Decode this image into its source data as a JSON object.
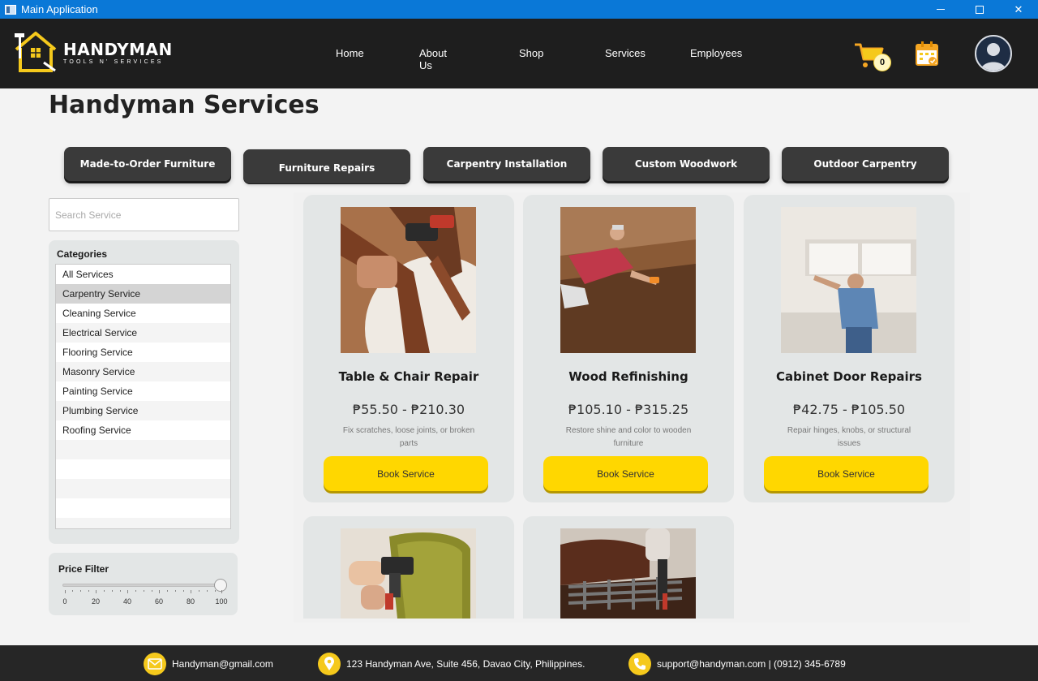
{
  "window": {
    "title": "Main Application",
    "minimize_icon": "minimize-icon",
    "maximize_icon": "maximize-icon",
    "close_glyph": "✕"
  },
  "brand": {
    "name": "HANDYMAN",
    "tagline": "TOOLS N' SERVICES",
    "accent": "#f5c91c"
  },
  "nav": {
    "items": [
      "Home",
      "About Us",
      "Shop",
      "Services",
      "Employees"
    ]
  },
  "header": {
    "cart_count": "0",
    "cart_icon": "cart-icon",
    "calendar_icon": "calendar-icon",
    "avatar_icon": "user-avatar-icon"
  },
  "page": {
    "title": "Handyman Services"
  },
  "tabs": [
    {
      "label": "Made-to-Order Furniture"
    },
    {
      "label": "Furniture Repairs",
      "active": true
    },
    {
      "label": "Carpentry Installation"
    },
    {
      "label": "Custom Woodwork"
    },
    {
      "label": "Outdoor Carpentry"
    }
  ],
  "search": {
    "placeholder": "Search Service",
    "value": ""
  },
  "categories": {
    "title": "Categories",
    "items": [
      "All Services",
      "Carpentry Service",
      "Cleaning Service",
      "Electrical Service",
      "Flooring Service",
      "Masonry Service",
      "Painting Service",
      "Plumbing Service",
      "Roofing Service"
    ],
    "selected": "Carpentry Service"
  },
  "price_filter": {
    "title": "Price Filter",
    "min": 0,
    "max": 100,
    "value": 100,
    "tick_labels": [
      "0",
      "20",
      "40",
      "60",
      "80",
      "100"
    ]
  },
  "services": [
    {
      "name": "Table & Chair Repair",
      "price": "₱55.50 - ₱210.30",
      "desc": "Fix scratches, loose joints, or broken parts",
      "button": "Book Service"
    },
    {
      "name": "Wood Refinishing",
      "price": "₱105.10 - ₱315.25",
      "desc": "Restore shine and color to wooden furniture",
      "button": "Book Service"
    },
    {
      "name": "Cabinet Door Repairs",
      "price": "₱42.75 - ₱105.50",
      "desc": "Repair hinges, knobs, or structural issues",
      "button": "Book Service"
    },
    {
      "name": "",
      "price": "",
      "desc": "",
      "button": ""
    },
    {
      "name": "",
      "price": "",
      "desc": "",
      "button": ""
    }
  ],
  "footer": {
    "email": "Handyman@gmail.com",
    "address": "123 Handyman Ave, Suite 456, Davao City, Philippines.",
    "support": "support@handyman.com | (0912) 345-6789"
  },
  "colors": {
    "header_bg": "#1e1e1e",
    "titlebar_bg": "#0a78d7",
    "button_yellow": "#ffd700",
    "tab_bg": "#3a3a3a",
    "card_bg": "#e3e6e6"
  }
}
